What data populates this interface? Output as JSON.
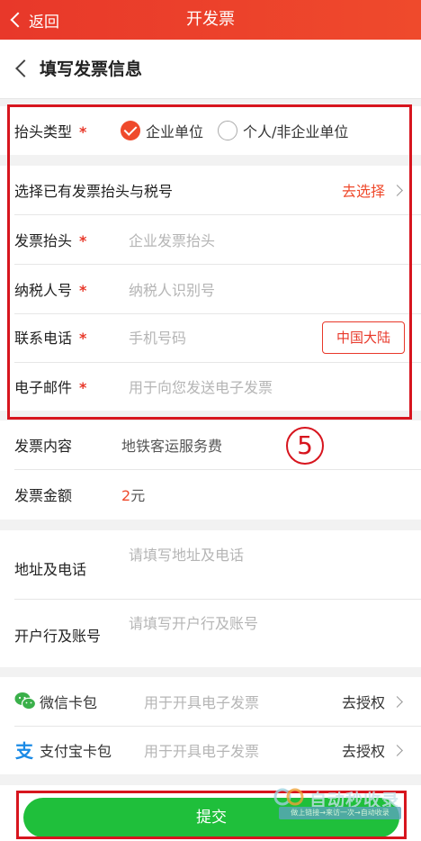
{
  "topbar": {
    "back_label": "返回",
    "title": "开发票"
  },
  "page_header": {
    "title": "填写发票信息"
  },
  "form": {
    "header_type": {
      "label": "抬头类型",
      "required_mark": "*",
      "options": [
        {
          "label": "企业单位",
          "selected": true
        },
        {
          "label": "个人/非企业单位",
          "selected": false
        }
      ]
    },
    "existing_header": {
      "label": "选择已有发票抬头与税号",
      "action": "去选择"
    },
    "invoice_title": {
      "label": "发票抬头",
      "required_mark": "*",
      "placeholder": "企业发票抬头"
    },
    "taxpayer_id": {
      "label": "纳税人号",
      "required_mark": "*",
      "placeholder": "纳税人识别号"
    },
    "phone": {
      "label": "联系电话",
      "required_mark": "*",
      "placeholder": "手机号码",
      "region": "中国大陆"
    },
    "email": {
      "label": "电子邮件",
      "required_mark": "*",
      "placeholder": "用于向您发送电子发票"
    }
  },
  "annotation": {
    "step_number": "5"
  },
  "content": {
    "label": "发票内容",
    "value": "地铁客运服务费"
  },
  "amount": {
    "label": "发票金额",
    "number": "2",
    "unit": "元"
  },
  "address": {
    "label": "地址及电话",
    "placeholder": "请填写地址及电话"
  },
  "bank": {
    "label": "开户行及账号",
    "placeholder": "请填写开户行及账号"
  },
  "wallets": [
    {
      "label": "微信卡包",
      "placeholder": "用于开具电子发票",
      "action": "去授权",
      "icon": "wechat-icon"
    },
    {
      "label": "支付宝卡包",
      "placeholder": "用于开具电子发票",
      "action": "去授权",
      "icon": "alipay-icon"
    }
  ],
  "submit": {
    "label": "提交"
  },
  "watermark": {
    "title": "自动秒收录",
    "subtitle": "做上链接→来访一次→自动收录"
  },
  "colors": {
    "accent": "#ef4a2c",
    "highlight": "#d7151e",
    "submit": "#1fbf3b"
  }
}
